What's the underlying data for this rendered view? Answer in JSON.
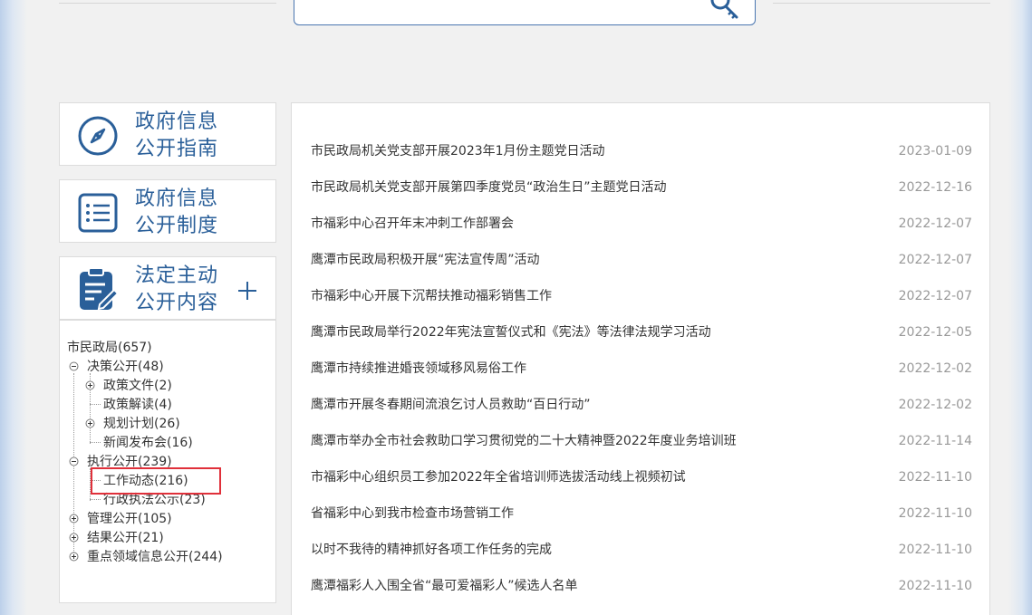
{
  "side_cards": [
    {
      "title_line1": "政府信息",
      "title_line2": "公开指南",
      "icon": "compass-icon"
    },
    {
      "title_line1": "政府信息",
      "title_line2": "公开制度",
      "icon": "list-icon"
    },
    {
      "title_line1": "法定主动",
      "title_line2": "公开内容",
      "icon": "clipboard-edit-icon"
    }
  ],
  "tree": {
    "root": "市民政局(657)",
    "items": [
      {
        "label": "决策公开(48)",
        "state": "expanded"
      },
      {
        "label": "政策文件(2)",
        "state": "collapsed"
      },
      {
        "label": "政策解读(4)",
        "state": "leaf"
      },
      {
        "label": "规划计划(26)",
        "state": "collapsed"
      },
      {
        "label": "新闻发布会(16)",
        "state": "leaf"
      },
      {
        "label": "执行公开(239)",
        "state": "expanded"
      },
      {
        "label": "工作动态(216)",
        "state": "leaf",
        "selected": true
      },
      {
        "label": "行政执法公示(23)",
        "state": "leaf"
      },
      {
        "label": "管理公开(105)",
        "state": "collapsed"
      },
      {
        "label": "结果公开(21)",
        "state": "collapsed"
      },
      {
        "label": "重点领域信息公开(244)",
        "state": "collapsed"
      }
    ]
  },
  "news": [
    {
      "title": "市民政局机关党支部开展2023年1月份主题党日活动",
      "date": "2023-01-09"
    },
    {
      "title": "市民政局机关党支部开展第四季度党员“政治生日”主题党日活动",
      "date": "2022-12-16"
    },
    {
      "title": "市福彩中心召开年末冲刺工作部署会",
      "date": "2022-12-07"
    },
    {
      "title": "鹰潭市民政局积极开展“宪法宣传周”活动",
      "date": "2022-12-07"
    },
    {
      "title": "市福彩中心开展下沉帮扶推动福彩销售工作",
      "date": "2022-12-07"
    },
    {
      "title": "鹰潭市民政局举行2022年宪法宣誓仪式和《宪法》等法律法规学习活动",
      "date": "2022-12-05"
    },
    {
      "title": "鹰潭市持续推进婚丧领域移风易俗工作",
      "date": "2022-12-02"
    },
    {
      "title": "鹰潭市开展冬春期间流浪乞讨人员救助“百日行动”",
      "date": "2022-12-02"
    },
    {
      "title": "鹰潭市举办全市社会救助口学习贯彻党的二十大精神暨2022年度业务培训班",
      "date": "2022-11-14"
    },
    {
      "title": "市福彩中心组织员工参加2022年全省培训师选拔活动线上视频初试",
      "date": "2022-11-10"
    },
    {
      "title": "省福彩中心到我市检查市场营销工作",
      "date": "2022-11-10"
    },
    {
      "title": "以时不我待的精神抓好各项工作任务的完成",
      "date": "2022-11-10"
    },
    {
      "title": "鹰潭福彩人入围全省“最可爱福彩人”候选人名单",
      "date": "2022-11-10"
    }
  ],
  "colors": {
    "accent": "#2a5f99",
    "date": "#999999",
    "highlight": "#e0303a",
    "border": "#4a76b0"
  }
}
